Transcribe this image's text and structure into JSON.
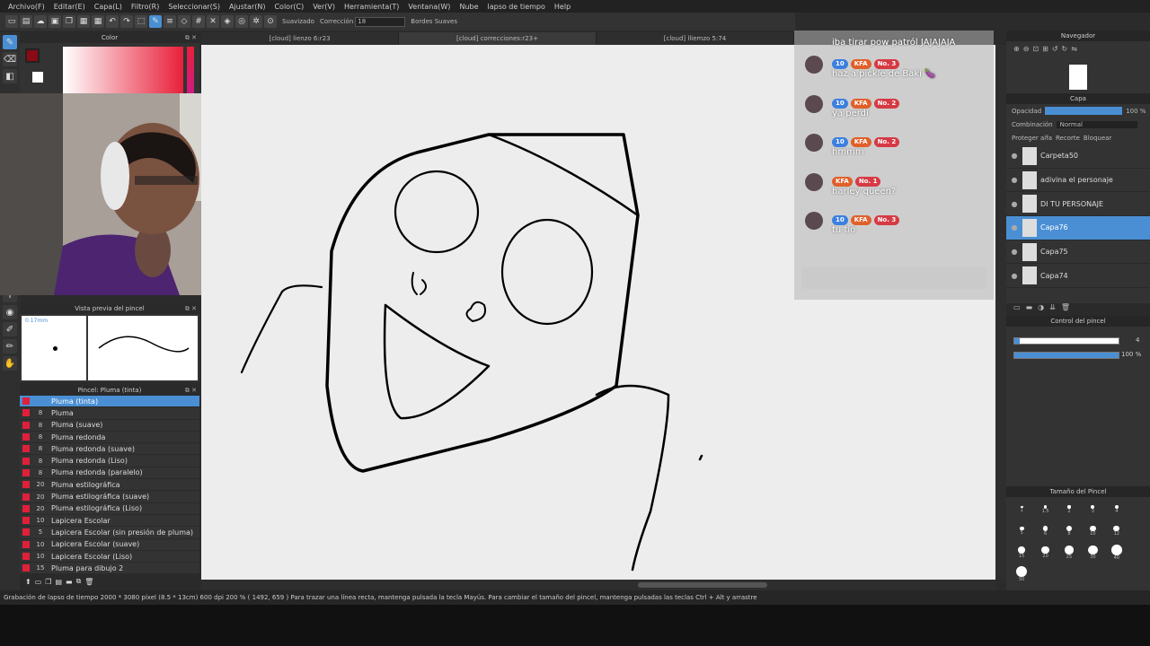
{
  "menu": [
    "Archivo(F)",
    "Editar(E)",
    "Capa(L)",
    "Filtro(R)",
    "Seleccionar(S)",
    "Ajustar(N)",
    "Color(C)",
    "Ver(V)",
    "Herramienta(T)",
    "Ventana(W)",
    "Nube",
    "lapso de tiempo",
    "Help"
  ],
  "toolbar": {
    "suavizado_label": "Suavizado",
    "correccion_label": "Corrección",
    "correccion_value": "18",
    "bordes_label": "Bordes Suaves"
  },
  "tabs": [
    "[cloud] lienzo 6:r23",
    "[cloud] correcciones:r23+",
    "[cloud] lliemzo 5:74"
  ],
  "color_panel": {
    "title": "Color",
    "main_color": "#8b0a14",
    "sub_color": "#ffffff"
  },
  "brush_preview": {
    "title": "Vista previa del pincel",
    "size_text": "0.17mm"
  },
  "brush_list": {
    "title": "Pincel: Pluma (tinta)",
    "items": [
      {
        "size": "",
        "name": "Pluma (tinta)",
        "selected": true
      },
      {
        "size": "8",
        "name": "Pluma"
      },
      {
        "size": "8",
        "name": "Pluma (suave)"
      },
      {
        "size": "8",
        "name": "Pluma redonda"
      },
      {
        "size": "8",
        "name": "Pluma redonda (suave)"
      },
      {
        "size": "8",
        "name": "Pluma redonda (Liso)"
      },
      {
        "size": "8",
        "name": "Pluma redonda (paralelo)"
      },
      {
        "size": "20",
        "name": "Pluma estilográfica"
      },
      {
        "size": "20",
        "name": "Pluma estilográfica (suave)"
      },
      {
        "size": "20",
        "name": "Pluma estilográfica (Liso)"
      },
      {
        "size": "10",
        "name": "Lapicera Escolar"
      },
      {
        "size": "5",
        "name": "Lapicera Escolar (sin presión de pluma)"
      },
      {
        "size": "10",
        "name": "Lapicera Escolar (suave)"
      },
      {
        "size": "10",
        "name": "Lapicera Escolar (Liso)"
      },
      {
        "size": "15",
        "name": "Pluma para dibujo 2"
      }
    ]
  },
  "chat": {
    "messages": [
      {
        "badges": [],
        "text": "iba tirar pow patról JAJAJAJA"
      },
      {
        "badges": [
          "10",
          "KFA",
          "No. 3"
        ],
        "text": "haz a pickle de Baki 🍆"
      },
      {
        "badges": [
          "10",
          "KFA",
          "No. 2"
        ],
        "text": "ya perdí"
      },
      {
        "badges": [
          "10",
          "KFA",
          "No. 2"
        ],
        "text": "hmmm"
      },
      {
        "badges": [
          "KFA",
          "No. 1"
        ],
        "text": "harley queen?"
      },
      {
        "badges": [
          "10",
          "KFA",
          "No. 3"
        ],
        "text": "tu tio"
      }
    ]
  },
  "navigator": {
    "title": "Navegador"
  },
  "layer_panel": {
    "title": "Capa",
    "opacity_label": "Opacidad",
    "opacity_value": "100 %",
    "opacity_level": 1.0,
    "blend_label": "Combinación",
    "blend_value": "Normal",
    "proteger_label": "Proteger alfa",
    "recorte_label": "Recorte",
    "bloquear_label": "Bloquear",
    "layers": [
      {
        "name": "Carpeta50",
        "selected": false
      },
      {
        "name": "adivina el personaje",
        "selected": false
      },
      {
        "name": "DI TU PERSONAJE",
        "selected": false
      },
      {
        "name": "Capa76",
        "selected": true
      },
      {
        "name": "Capa75",
        "selected": false
      },
      {
        "name": "Capa74",
        "selected": false
      }
    ]
  },
  "brush_control": {
    "title": "Control del pincel",
    "size_value": "4",
    "opacity_value": "100 %",
    "size_level": 0.05,
    "opacity_level": 1.0
  },
  "brush_size": {
    "title": "Tamaño del Pincel",
    "sizes": [
      "1",
      "1.5",
      "2",
      "3",
      "4",
      "5",
      "6",
      "8",
      "10",
      "12",
      "15",
      "20",
      "25",
      "30",
      "40",
      "50"
    ]
  },
  "status": {
    "text": "Grabación de lapso de tiempo  2000 * 3080 píxel  (8.5 * 13cm)  600 dpi  200 %  ( 1492, 659 )  Para trazar una línea recta, mantenga pulsada la tecla Mayús. Para cambiar el tamaño del pincel, mantenga pulsadas las teclas Ctrl + Alt y arrastre"
  },
  "colors": {
    "accent": "#4a8fd4",
    "panel": "#333333",
    "canvas": "#ededed"
  }
}
